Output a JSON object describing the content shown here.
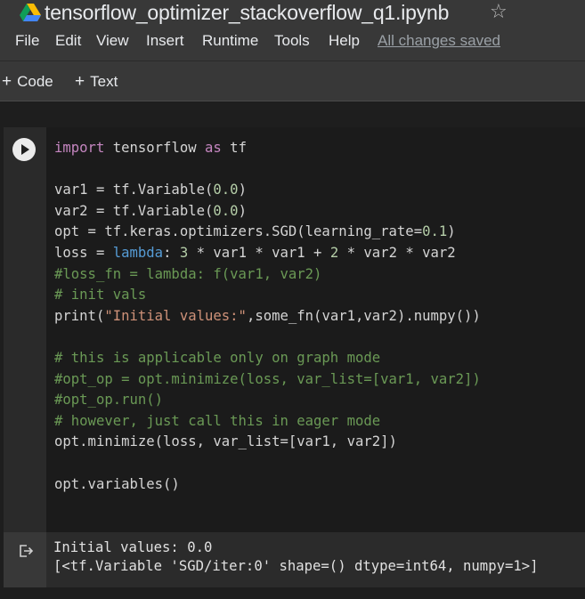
{
  "header": {
    "title": "tensorflow_optimizer_stackoverflow_q1.ipynb",
    "icon": "google-drive-icon",
    "star_icon": "star-outline-icon"
  },
  "menu": {
    "items": [
      "File",
      "Edit",
      "View",
      "Insert",
      "Runtime",
      "Tools",
      "Help"
    ],
    "save_status": "All changes saved"
  },
  "toolbar": {
    "code_label": "Code",
    "text_label": "Text"
  },
  "cell": {
    "run_icon": "play-icon",
    "code_lines": [
      "import tensorflow as tf",
      "",
      "var1 = tf.Variable(0.0)",
      "var2 = tf.Variable(0.0)",
      "opt = tf.keras.optimizers.SGD(learning_rate=0.1)",
      "loss = lambda: 3 * var1 * var1 + 2 * var2 * var2",
      "#loss_fn = lambda: f(var1, var2)",
      "# init vals",
      "print(\"Initial values:\",some_fn(var1,var2).numpy())",
      "",
      "# this is applicable only on graph mode",
      "#opt_op = opt.minimize(loss, var_list=[var1, var2])",
      "#opt_op.run()",
      "# however, just call this in eager mode",
      "opt.minimize(loss, var_list=[var1, var2])",
      "",
      "opt.variables()"
    ]
  },
  "output": {
    "icon": "output-redirect-icon",
    "lines": [
      "Initial values: 0.0",
      "[<tf.Variable 'SGD/iter:0' shape=() dtype=int64, numpy=1>]"
    ]
  },
  "colors": {
    "keyword": "#c586c0",
    "builtin": "#569cd6",
    "number": "#b5cea8",
    "string": "#ce9178",
    "comment": "#6a9955"
  }
}
